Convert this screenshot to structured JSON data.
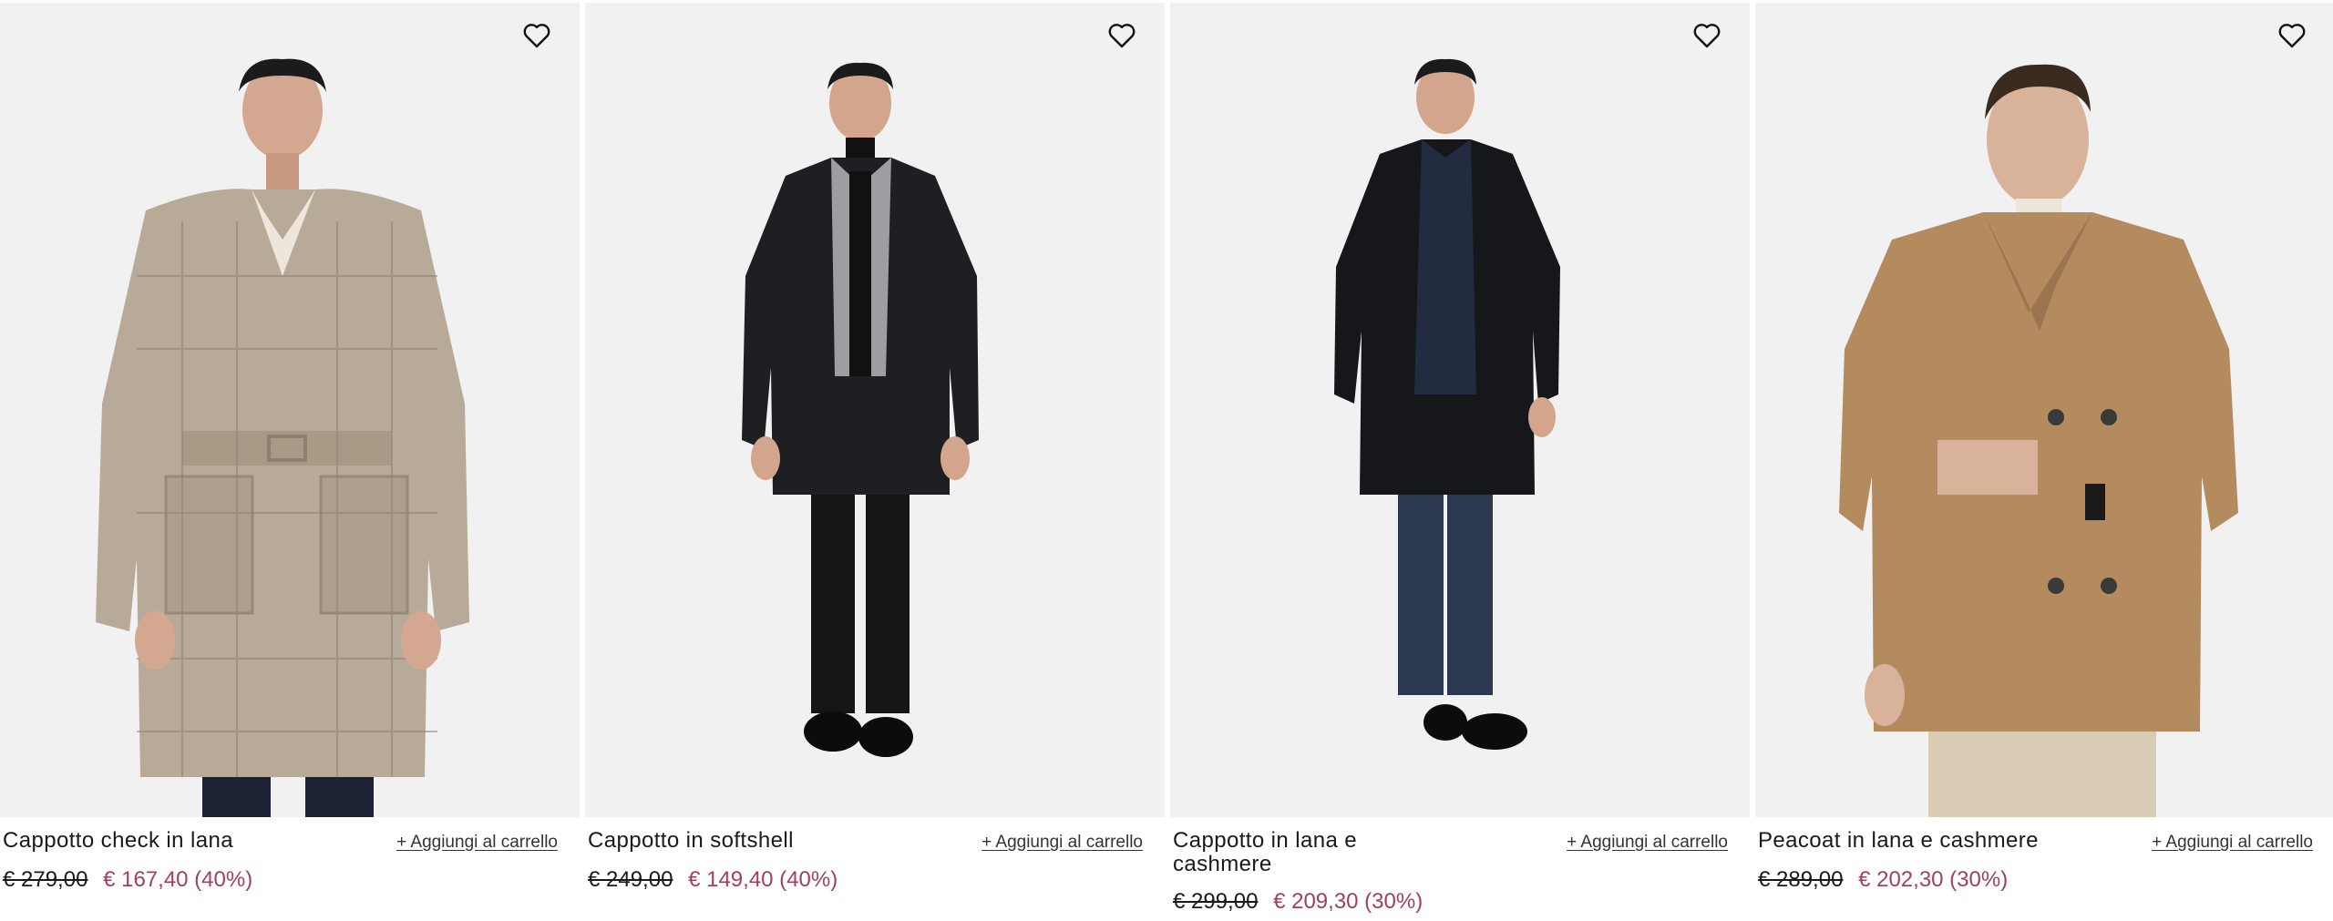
{
  "products": [
    {
      "name": "Cappotto check in lana",
      "old_price": "€ 279,00",
      "new_price": "€ 167,40 (40%)",
      "add_to_cart": "+ Aggiungi al carrello",
      "wishlist_icon": "heart-outline-icon",
      "coat_color": "#b8aa98"
    },
    {
      "name": "Cappotto in softshell",
      "old_price": "€ 249,00",
      "new_price": "€ 149,40 (40%)",
      "add_to_cart": "+ Aggiungi al carrello",
      "wishlist_icon": "heart-outline-icon",
      "coat_color": "#1e1f22"
    },
    {
      "name": "Cappotto in lana e cashmere",
      "old_price": "€ 299,00",
      "new_price": "€ 209,30 (30%)",
      "add_to_cart": "+ Aggiungi al carrello",
      "wishlist_icon": "heart-outline-icon",
      "coat_color": "#15171b"
    },
    {
      "name": "Peacoat in lana e cashmere",
      "old_price": "€ 289,00",
      "new_price": "€ 202,30 (30%)",
      "add_to_cart": "+ Aggiungi al carrello",
      "wishlist_icon": "heart-outline-icon",
      "coat_color": "#b48a5f"
    }
  ],
  "colors": {
    "sale_price": "#a2405c",
    "photo_background": "#f1f1f1"
  }
}
